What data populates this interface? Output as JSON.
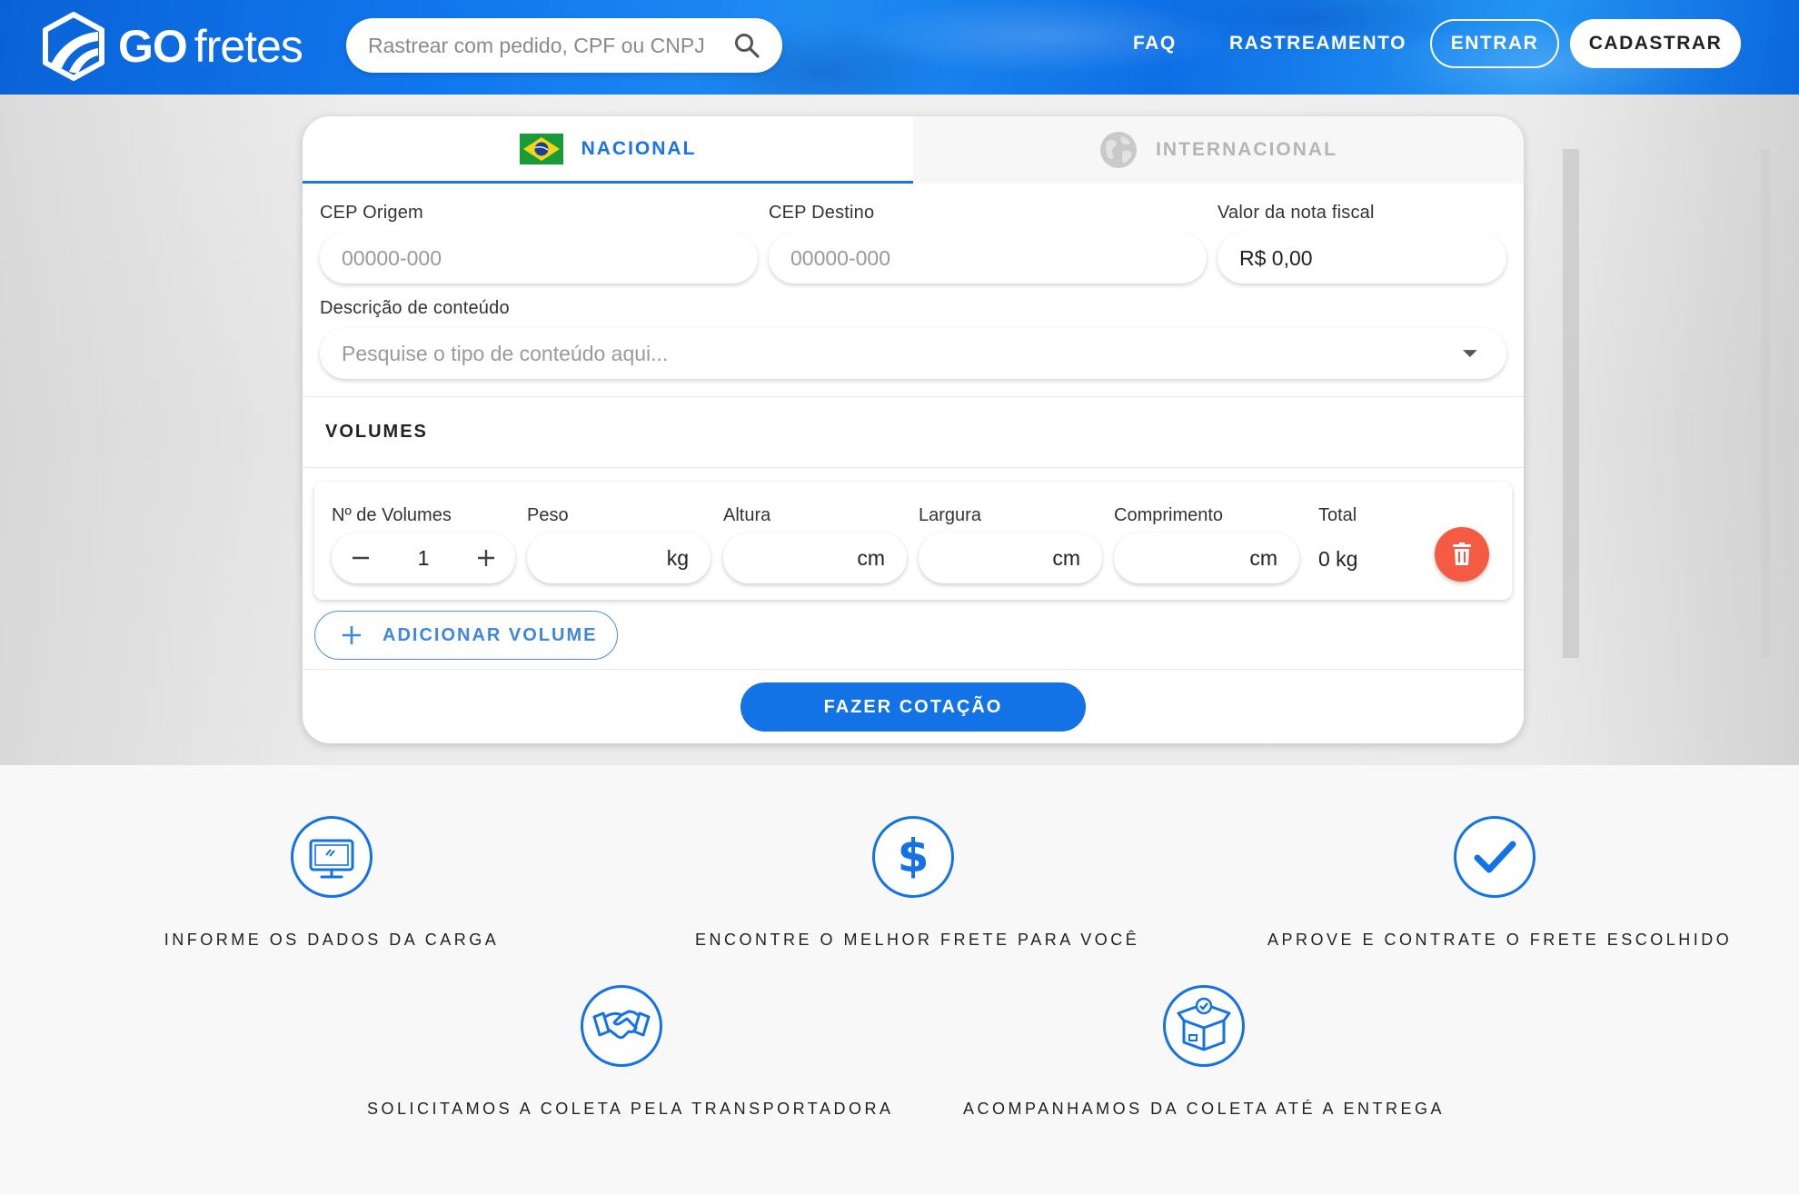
{
  "header": {
    "logo_go": "GO",
    "logo_fretes": "fretes",
    "search_placeholder": "Rastrear com pedido, CPF ou CNPJ",
    "nav": {
      "faq": "FAQ",
      "rastreamento": "RASTREAMENTO",
      "entrar": "ENTRAR",
      "cadastrar": "CADASTRAR"
    }
  },
  "tabs": {
    "nacional": "NACIONAL",
    "internacional": "INTERNACIONAL",
    "active": "nacional"
  },
  "form": {
    "cep_origem_label": "CEP Origem",
    "cep_origem_placeholder": "00000-000",
    "cep_destino_label": "CEP Destino",
    "cep_destino_placeholder": "00000-000",
    "valor_label": "Valor da nota fiscal",
    "valor_value": "R$ 0,00",
    "descricao_label": "Descrição de conteúdo",
    "descricao_placeholder": "Pesquise o tipo de conteúdo aqui..."
  },
  "volumes": {
    "title": "VOLUMES",
    "headers": {
      "num": "Nº de Volumes",
      "peso": "Peso",
      "altura": "Altura",
      "largura": "Largura",
      "comprimento": "Comprimento",
      "total": "Total"
    },
    "units": {
      "peso": "kg",
      "altura": "cm",
      "largura": "cm",
      "comprimento": "cm"
    },
    "quantity": "1",
    "total": "0 kg",
    "add_label": "ADICIONAR VOLUME"
  },
  "quote_button": "FAZER COTAÇÃO",
  "features": [
    {
      "text": "INFORME OS DADOS DA CARGA",
      "icon": "monitor-icon"
    },
    {
      "text": "ENCONTRE O MELHOR FRETE PARA VOCÊ",
      "icon": "dollar-icon"
    },
    {
      "text": "APROVE E CONTRATE O FRETE ESCOLHIDO",
      "icon": "check-icon"
    },
    {
      "text": "SOLICITAMOS A COLETA PELA TRANSPORTADORA",
      "icon": "handshake-icon"
    },
    {
      "text": "ACOMPANHAMOS DA COLETA ATÉ A ENTREGA",
      "icon": "box-icon"
    }
  ],
  "colors": {
    "primary": "#1373e6",
    "danger": "#f45b42",
    "header_blue": "#1177ee"
  }
}
